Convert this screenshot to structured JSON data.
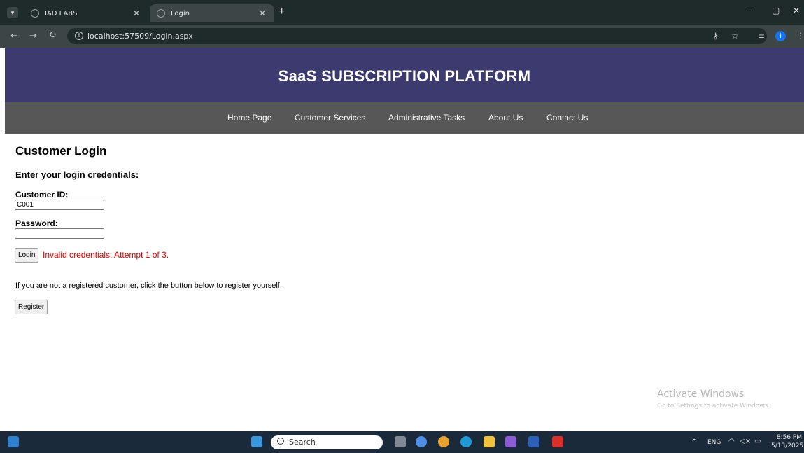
{
  "browser": {
    "tabs": [
      {
        "label": "IAD LABS",
        "active": false
      },
      {
        "label": "Login",
        "active": true
      }
    ],
    "new_tab": "+",
    "url": "localhost:57509/Login.aspx",
    "window_controls": {
      "minimize": "–",
      "maximize": "▢",
      "close": "✕"
    }
  },
  "site": {
    "title": "SaaS SUBSCRIPTION PLATFORM",
    "nav": [
      "Home Page",
      "Customer Services",
      "Administrative Tasks",
      "About Us",
      "Contact Us"
    ],
    "header_color": "#3c3a6e",
    "nav_color": "#575757"
  },
  "login": {
    "heading": "Customer Login",
    "subheading": "Enter your login credentials:",
    "customer_id_label": "Customer ID:",
    "customer_id_value": "C001",
    "password_label": "Password:",
    "password_value": "",
    "login_button": "Login",
    "error_message": "Invalid credentials. Attempt 1 of 3.",
    "error_color": "#e00000",
    "register_prompt": "If you are not a registered customer, click the button below to register yourself.",
    "register_button": "Register"
  },
  "watermark": {
    "title": "Activate Windows",
    "subtitle": "Go to Settings to activate Windows."
  },
  "taskbar": {
    "search_placeholder": "Search",
    "language": "ENG",
    "time": "8:56 PM",
    "date": "5/13/2025"
  }
}
